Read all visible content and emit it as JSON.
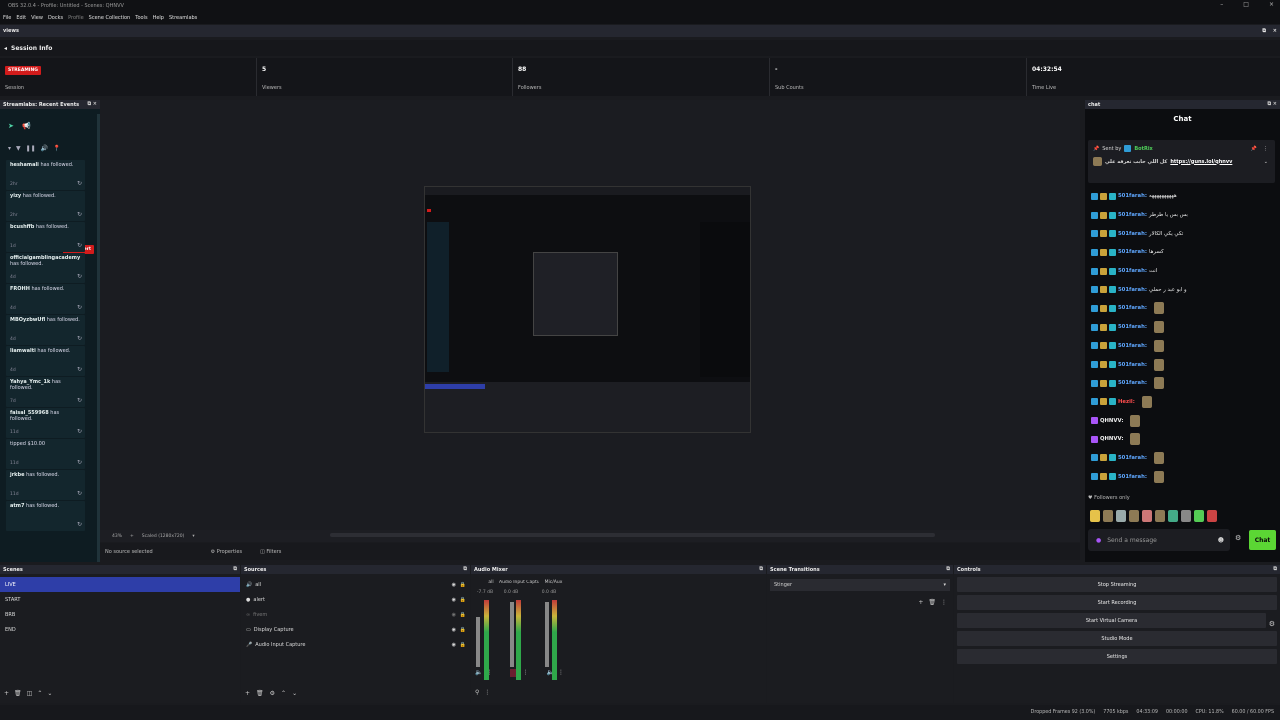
{
  "window": {
    "title": "OBS 32.0.4 - Profile: Untitled - Scenes: QHNVV"
  },
  "menu": [
    "File",
    "Edit",
    "View",
    "Docks",
    "Profile",
    "Scene Collection",
    "Tools",
    "Help",
    "Streamlabs"
  ],
  "views_title": "views",
  "session": {
    "header": "Session Info",
    "badge": "STREAMING",
    "cells": [
      {
        "value": "",
        "label": "Session"
      },
      {
        "value": "5",
        "label": "Viewers"
      },
      {
        "value": "88",
        "label": "Followers"
      },
      {
        "value": "-",
        "label": "Sub Counts"
      },
      {
        "value": "04:32:54",
        "label": "Time Live"
      }
    ]
  },
  "events": {
    "title": "Streamlabs: Recent Events",
    "skip_alert": "Skip Alert",
    "items": [
      {
        "name": "heshamali",
        "action": "has followed.",
        "time": "2hr"
      },
      {
        "name": "yizy",
        "action": "has followed.",
        "time": "2hr"
      },
      {
        "name": "bcushffb",
        "action": "has followed.",
        "time": "1d"
      },
      {
        "name": "officialgamblingacademy",
        "action": "has followed.",
        "time": "4d"
      },
      {
        "name": "FROHH",
        "action": "has followed.",
        "time": "4d"
      },
      {
        "name": "MBOyzbwUfl",
        "action": "has followed.",
        "time": "4d"
      },
      {
        "name": "liamwalti",
        "action": "has followed.",
        "time": "4d"
      },
      {
        "name": "Yahya_Ymc_1k",
        "action": "has followed.",
        "time": "7d"
      },
      {
        "name": "faisal_559968",
        "action": "has followed.",
        "time": "11d"
      },
      {
        "name": "",
        "action": "tipped $10.00",
        "time": "11d"
      },
      {
        "name": "jrkbe",
        "action": "has followed.",
        "time": "11d"
      },
      {
        "name": "atm7",
        "action": "has followed.",
        "time": ""
      }
    ]
  },
  "preview": {
    "zoom": "43%",
    "scaled": "Scaled (1280x720)",
    "no_source": "No source selected",
    "properties": "Properties",
    "filters": "Filters"
  },
  "chat": {
    "dock_title": "chat",
    "title": "Chat",
    "pinned_sender": "Sent by",
    "pinned_bot": "BotRix",
    "pinned_text": "كل اللي حابب تعرفه علي",
    "pinned_link": "https://guns.lol/qhnvv",
    "messages": [
      {
        "user": "501farah:",
        "text": "ههههههههههه"
      },
      {
        "user": "501farah:",
        "text": "بس بس يا طرطر"
      },
      {
        "user": "501farah:",
        "text": "تكي يكي الكالار"
      },
      {
        "user": "501farah:",
        "text": "كسرها"
      },
      {
        "user": "501farah:",
        "text": "انت"
      },
      {
        "user": "501farah:",
        "text": "و ابو عبد ر حملي"
      },
      {
        "user": "501farah:",
        "text": ""
      },
      {
        "user": "501farah:",
        "text": ""
      },
      {
        "user": "501farah:",
        "text": ""
      },
      {
        "user": "501farah:",
        "text": ""
      },
      {
        "user": "501farah:",
        "text": ""
      },
      {
        "user": "Hezil:",
        "text": ""
      },
      {
        "user": "QHNVV:",
        "text": ""
      },
      {
        "user": "QHNVV:",
        "text": ""
      },
      {
        "user": "501farah:",
        "text": ""
      },
      {
        "user": "501farah:",
        "text": ""
      }
    ],
    "followers_only": "Followers only",
    "placeholder": "Send a message",
    "send_label": "Chat"
  },
  "scenes": {
    "title": "Scenes",
    "items": [
      "LIVE",
      "START",
      "BRB",
      "END"
    ],
    "selected": 0
  },
  "sources": {
    "title": "Sources",
    "items": [
      "all",
      "alert",
      "fivem",
      "Display Capture",
      "Audio Input Capture"
    ]
  },
  "mixer": {
    "title": "Audio Mixer",
    "channels": [
      {
        "name": "all",
        "db": "-7.7 dB"
      },
      {
        "name": "Audio Input Captu",
        "db": "0.0 dB"
      },
      {
        "name": "Mic/Aux",
        "db": "0.0 dB"
      }
    ]
  },
  "transitions": {
    "title": "Scene Transitions",
    "selected": "Stinger"
  },
  "controls": {
    "title": "Controls",
    "buttons": [
      "Stop Streaming",
      "Start Recording",
      "Start Virtual Camera",
      "Studio Mode",
      "Settings"
    ]
  },
  "status": {
    "dropped": "Dropped Frames 92 (3.0%)",
    "bitrate": "7705 kbps",
    "time_live": "04:33:09",
    "rec_time": "00:00:00",
    "cpu": "CPU: 11.8%",
    "fps": "60.00 / 60.00 FPS"
  },
  "colors": {
    "streaming": "#d21b1b",
    "accent": "#2e3ea8",
    "chat_send": "#5bd634"
  }
}
